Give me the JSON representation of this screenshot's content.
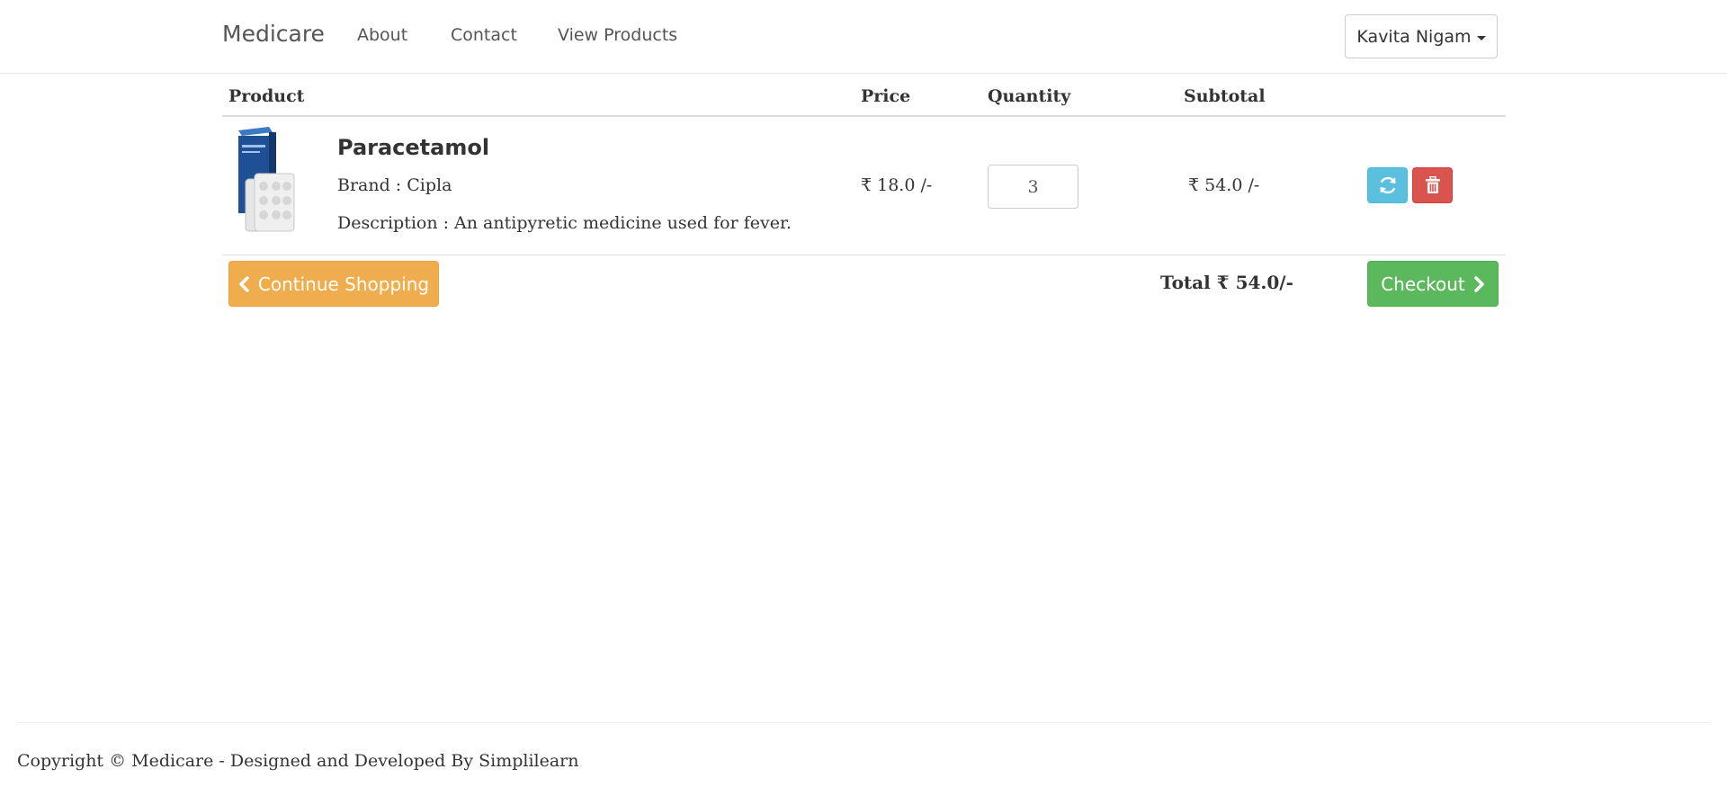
{
  "navbar": {
    "brand": "Medicare",
    "links": [
      "About",
      "Contact",
      "View Products"
    ],
    "user_menu": "Kavita Nigam"
  },
  "cart": {
    "headers": {
      "product": "Product",
      "price": "Price",
      "quantity": "Quantity",
      "subtotal": "Subtotal"
    },
    "items": [
      {
        "name": "Paracetamol",
        "brand": "Brand : Cipla",
        "description": "Description : An antipyretic medicine used for fever.",
        "price": "₹ 18.0 /-",
        "quantity": "3",
        "subtotal": "₹ 54.0 /-"
      }
    ],
    "continue_label": "Continue Shopping",
    "total": "Total ₹ 54.0/-",
    "checkout_label": "Checkout"
  },
  "footer": {
    "copyright": "Copyright © Medicare - Designed and Developed By Simplilearn"
  },
  "icons": {
    "refresh": "refresh-icon",
    "delete": "trash-icon",
    "continue": "chevron-left-icon",
    "checkout": "chevron-right-icon",
    "user_menu": "caret-down-icon"
  },
  "colors": {
    "refresh_button": "#5bc0de",
    "delete_button": "#d9534f",
    "continue_button": "#f0ad4e",
    "checkout_button": "#5cb85c"
  }
}
